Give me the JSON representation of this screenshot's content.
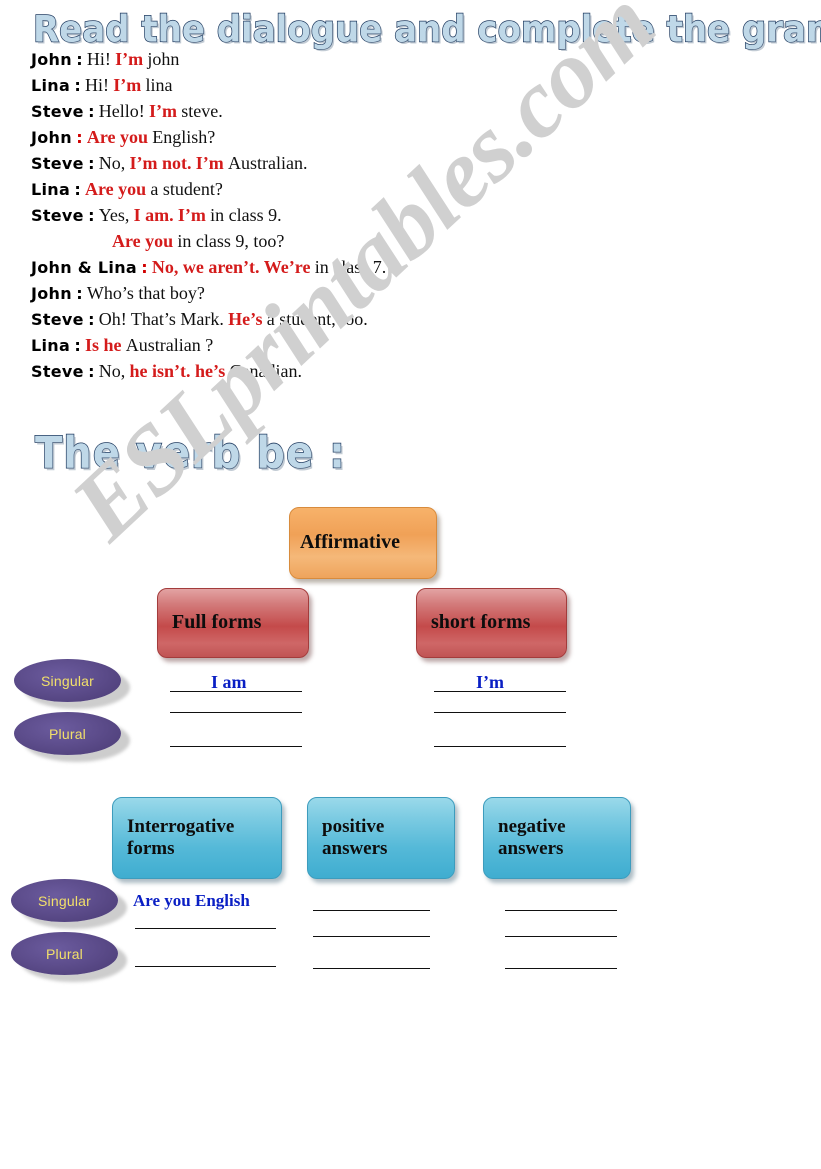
{
  "headings": {
    "main_title": "Read the dialogue and complete the grammar tables",
    "verb_title": "The verb be :"
  },
  "watermark": "ESLprintables.com",
  "dialogue": [
    {
      "speaker": "John",
      "colon": ":",
      "colon_red": false,
      "parts": [
        {
          "t": "Hi!",
          "style": "plain"
        },
        {
          "t": "I’m",
          "style": "hl"
        },
        {
          "t": "john",
          "style": "plain"
        }
      ]
    },
    {
      "speaker": "Lina",
      "colon": ":",
      "colon_red": false,
      "parts": [
        {
          "t": "Hi!",
          "style": "plain"
        },
        {
          "t": "I’m",
          "style": "hl"
        },
        {
          "t": "lina",
          "style": "plain"
        }
      ]
    },
    {
      "speaker": "Steve",
      "colon": ":",
      "colon_red": false,
      "parts": [
        {
          "t": "Hello!",
          "style": "plain"
        },
        {
          "t": "I’m",
          "style": "hl"
        },
        {
          "t": "steve.",
          "style": "plain"
        }
      ]
    },
    {
      "speaker": "John",
      "colon": ":",
      "colon_red": true,
      "parts": [
        {
          "t": "Are you",
          "style": "hl"
        },
        {
          "t": "English?",
          "style": "plain"
        }
      ]
    },
    {
      "speaker": "Steve",
      "colon": ":",
      "colon_red": false,
      "parts": [
        {
          "t": "No,",
          "style": "plain"
        },
        {
          "t": "I’m not.",
          "style": "hl"
        },
        {
          "t": "I’m",
          "style": "hl"
        },
        {
          "t": "Australian.",
          "style": "plain"
        }
      ]
    },
    {
      "speaker": "Lina",
      "colon": ":",
      "colon_red": false,
      "parts": [
        {
          "t": "Are you",
          "style": "hl"
        },
        {
          "t": "a student?",
          "style": "plain"
        }
      ]
    },
    {
      "speaker": "Steve",
      "colon": ":",
      "colon_red": false,
      "parts": [
        {
          "t": "Yes,",
          "style": "plain"
        },
        {
          "t": "I am.",
          "style": "hl"
        },
        {
          "t": "I’m",
          "style": "hl"
        },
        {
          "t": "in class 9.",
          "style": "plain"
        }
      ]
    },
    {
      "speaker": "",
      "colon": "",
      "colon_red": false,
      "indent": true,
      "parts": [
        {
          "t": "Are you",
          "style": "hl"
        },
        {
          "t": "in class 9, too?",
          "style": "plain"
        }
      ]
    },
    {
      "speaker": "John & Lina",
      "colon": ":",
      "colon_red": true,
      "parts": [
        {
          "t": "No, we aren’t.",
          "style": "hl"
        },
        {
          "t": "We’re",
          "style": "hl"
        },
        {
          "t": "in class 7.",
          "style": "plain"
        }
      ]
    },
    {
      "speaker": "John",
      "colon": ":",
      "colon_red": false,
      "parts": [
        {
          "t": "Who’s that boy?",
          "style": "plain"
        }
      ]
    },
    {
      "speaker": "Steve",
      "colon": ":",
      "colon_red": false,
      "parts": [
        {
          "t": "Oh! That’s Mark.",
          "style": "plain"
        },
        {
          "t": "He’s",
          "style": "hl"
        },
        {
          "t": "a student, too.",
          "style": "plain"
        }
      ]
    },
    {
      "speaker": "Lina",
      "colon": ":",
      "colon_red": false,
      "parts": [
        {
          "t": "Is he",
          "style": "hl"
        },
        {
          "t": "Australian ?",
          "style": "plain"
        }
      ]
    },
    {
      "speaker": "Steve",
      "colon": ":",
      "colon_red": false,
      "parts": [
        {
          "t": "No,",
          "style": "plain"
        },
        {
          "t": "he isn’t. he’s",
          "style": "hl"
        },
        {
          "t": "Canadian.",
          "style": "plain"
        }
      ]
    }
  ],
  "affirmative_table": {
    "header": "Affirmative",
    "col_full": "Full forms",
    "col_short": "short forms",
    "row_singular": "Singular",
    "row_plural": "Plural",
    "answer_full": "I am",
    "answer_short": "I’m"
  },
  "question_table": {
    "col_interrogative": "Interrogative forms",
    "col_positive": "positive answers",
    "col_negative": "negative answers",
    "row_singular": "Singular",
    "row_plural": "Plural",
    "answer_interrogative": "Are you English"
  },
  "colors": {
    "highlight_red": "#d41b1b",
    "answer_blue": "#0a1fc4",
    "wordart_fill": "#bfd8e8",
    "wordart_outline": "#1f3a5f",
    "box_orange": "#f0a157",
    "box_red": "#c44a4a",
    "box_cyan": "#55b9d8",
    "pill_purple": "#5d4d8c",
    "pill_text": "#f2e06a",
    "watermark_gray": "#d0d0d0"
  }
}
